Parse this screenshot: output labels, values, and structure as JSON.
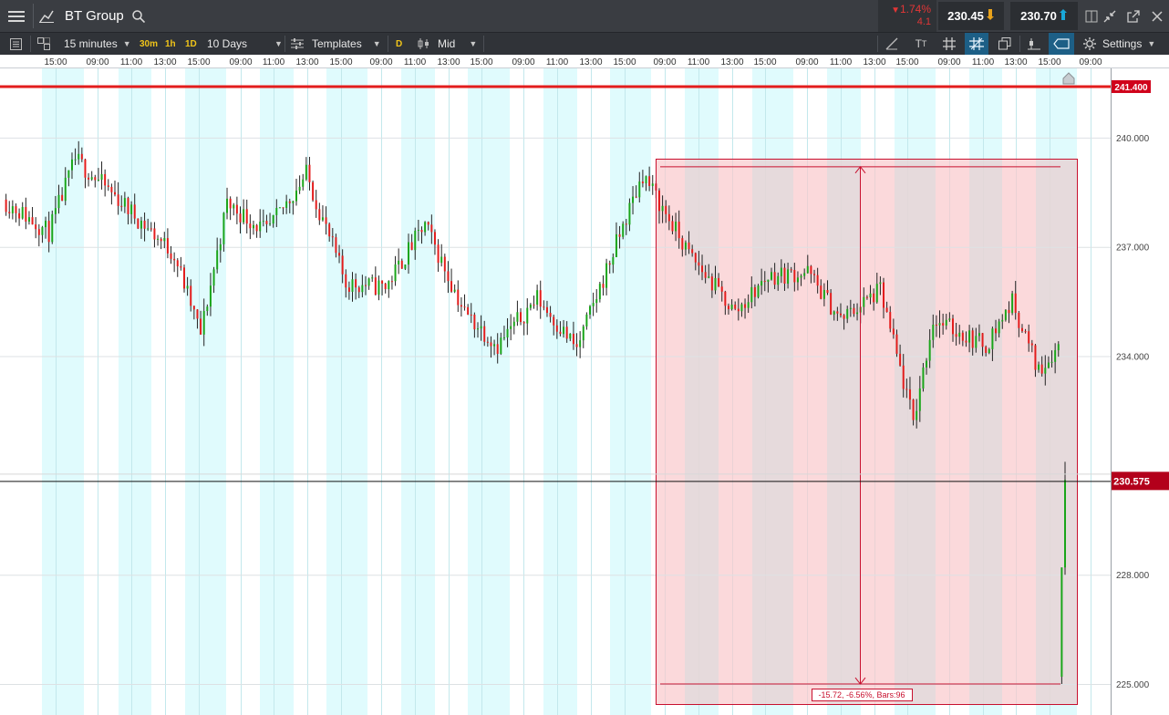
{
  "header": {
    "instrument": "BT Group",
    "change_percent": "1.74%",
    "change_points": "4.1",
    "sell_price": "230.45",
    "buy_price": "230.70"
  },
  "toolbar": {
    "interval": "15 minutes",
    "quick_intervals": [
      "30m",
      "1h",
      "1D"
    ],
    "range": "10 Days",
    "templates_label": "Templates",
    "d_label": "D",
    "price_type": "Mid",
    "settings_label": "Settings"
  },
  "colors": {
    "up": "#1aa51a",
    "down": "#e31c1c",
    "session_band": "#e0fbfd",
    "measure_fill": "#f9c9cc",
    "measure_border": "#c8102e",
    "price_line": "#e31c1c",
    "accent_cyan": "#00b8e6"
  },
  "chart_data": {
    "type": "candlestick",
    "x_tick_labels": [
      "15:00",
      "09:00",
      "11:00",
      "13:00",
      "15:00",
      "09:00",
      "11:00",
      "13:00",
      "15:00",
      "09:00",
      "11:00",
      "13:00",
      "15:00",
      "09:00",
      "11:00",
      "13:00",
      "15:00",
      "09:00",
      "11:00",
      "13:00",
      "15:00",
      "09:00",
      "11:00",
      "13:00",
      "15:00",
      "09:00",
      "11:00",
      "13:00",
      "15:00",
      "09:00"
    ],
    "y_tick_labels": [
      "240.000",
      "237.000",
      "234.000",
      "228.000",
      "225.000"
    ],
    "y_ticks": [
      240,
      237,
      234,
      228,
      225
    ],
    "ylim": [
      224.2,
      241.9
    ],
    "horizontal_line": {
      "value": 241.4,
      "label": "241.400"
    },
    "current_price": {
      "value": 230.575,
      "label": "230.575"
    },
    "measure": {
      "label": "-15.72, -6.56%, Bars:96",
      "from_value": 239.2,
      "to_value": 225.0
    },
    "anchors": [
      {
        "bar": 0,
        "close": 238.3
      },
      {
        "bar": 14,
        "close": 237.4
      },
      {
        "bar": 22,
        "close": 239.4
      },
      {
        "bar": 34,
        "close": 238.4
      },
      {
        "bar": 52,
        "close": 236.8
      },
      {
        "bar": 60,
        "close": 234.6
      },
      {
        "bar": 68,
        "close": 238.2
      },
      {
        "bar": 80,
        "close": 237.4
      },
      {
        "bar": 92,
        "close": 239.0
      },
      {
        "bar": 104,
        "close": 236.0
      },
      {
        "bar": 116,
        "close": 235.9
      },
      {
        "bar": 128,
        "close": 237.6
      },
      {
        "bar": 140,
        "close": 235.2
      },
      {
        "bar": 150,
        "close": 234.3
      },
      {
        "bar": 162,
        "close": 235.6
      },
      {
        "bar": 174,
        "close": 234.2
      },
      {
        "bar": 184,
        "close": 236.6
      },
      {
        "bar": 194,
        "close": 239.0
      },
      {
        "bar": 208,
        "close": 236.8
      },
      {
        "bar": 222,
        "close": 235.2
      },
      {
        "bar": 232,
        "close": 236.2
      },
      {
        "bar": 244,
        "close": 236.3
      },
      {
        "bar": 254,
        "close": 235.0
      },
      {
        "bar": 266,
        "close": 235.8
      },
      {
        "bar": 276,
        "close": 232.2
      },
      {
        "bar": 282,
        "close": 235.0
      },
      {
        "bar": 298,
        "close": 234.3
      },
      {
        "bar": 306,
        "close": 235.5
      },
      {
        "bar": 314,
        "close": 233.6
      },
      {
        "bar": 320,
        "close": 234.3
      }
    ],
    "final_bars": [
      {
        "open": 225.2,
        "high": 228.2,
        "low": 225.0,
        "close": 228.2
      },
      {
        "open": 228.2,
        "high": 231.1,
        "low": 228.0,
        "close": 230.6
      }
    ]
  }
}
